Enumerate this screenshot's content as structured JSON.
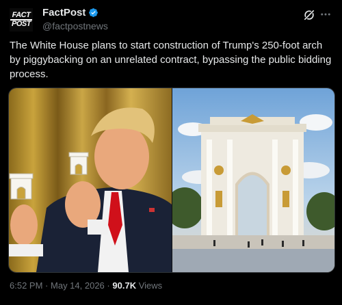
{
  "post": {
    "display_name": "FactPost",
    "handle": "@factpostnews",
    "avatar_text_1": "FACT",
    "avatar_text_2": "POST",
    "text": "The White House plans to start construction of Trump's 250-foot arch by piggybacking on an unrelated contract, bypassing the public bidding process.",
    "time": "6:52 PM",
    "separator": "·",
    "date": "May 14, 2026",
    "views_count": "90.7K",
    "views_label": "Views"
  },
  "icons": {
    "verified": "verified-badge-icon",
    "grok": "grok-icon",
    "more": "more-icon"
  },
  "colors": {
    "background": "#000000",
    "text": "#e7e9ea",
    "secondary_text": "#71767b",
    "verified_blue": "#1d9bf0"
  }
}
